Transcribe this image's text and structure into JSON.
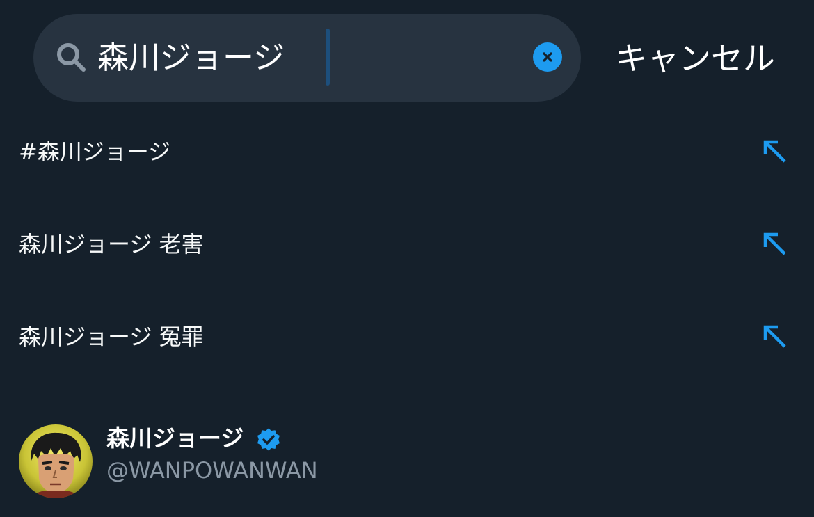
{
  "search": {
    "query": "森川ジョージ",
    "cancel_label": "キャンセル"
  },
  "suggestions": [
    {
      "label": "#森川ジョージ",
      "icon": "arrow-up-left-icon"
    },
    {
      "label": "森川ジョージ 老害",
      "icon": "arrow-up-left-icon"
    },
    {
      "label": "森川ジョージ 冤罪",
      "icon": "arrow-up-left-icon"
    }
  ],
  "user": {
    "name": "森川ジョージ",
    "handle": "@WANPOWANWAN",
    "verified": true
  },
  "colors": {
    "background": "#15202b",
    "search_bg": "#273340",
    "accent": "#1d9bf0",
    "secondary_text": "#8b98a5",
    "divider": "#38444d"
  }
}
